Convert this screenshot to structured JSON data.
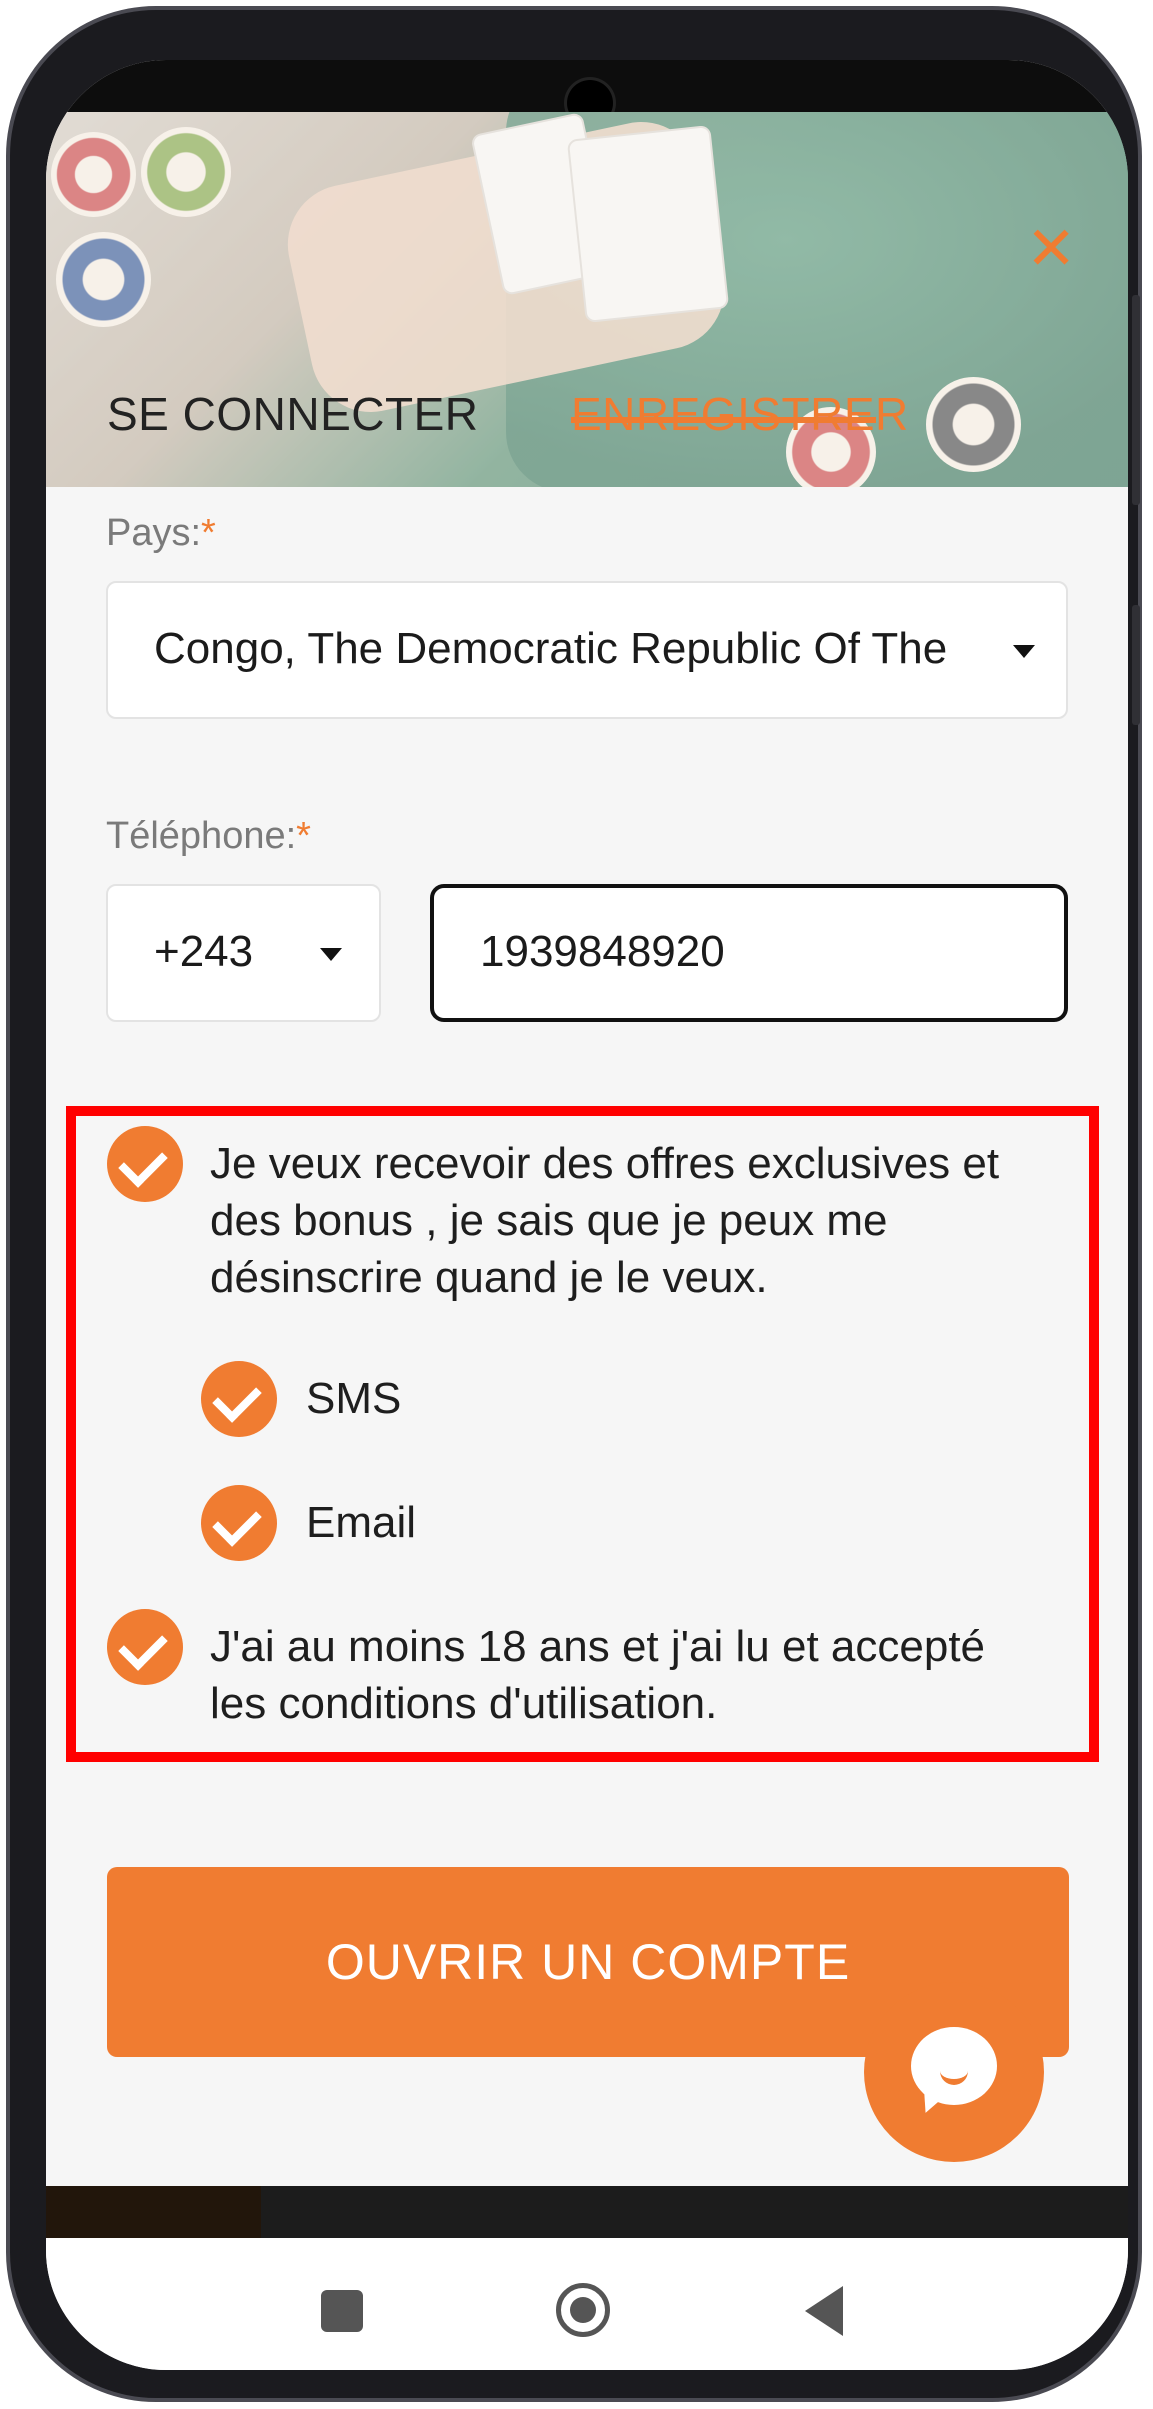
{
  "header": {
    "tabs": [
      {
        "label": "SE CONNECTER",
        "active": false
      },
      {
        "label": "ENREGISTRER",
        "active": true
      }
    ],
    "close_icon": "close-icon",
    "background_image": "casino-cards-chips-photo"
  },
  "form": {
    "country": {
      "label": "Pays:",
      "required_marker": "*",
      "value": "Congo, The Democratic Republic Of The"
    },
    "phone": {
      "label": "Téléphone:",
      "required_marker": "*",
      "country_code": "+243",
      "number": "1939848920"
    },
    "options": {
      "promo": {
        "checked": true,
        "lines": [
          "Je veux recevoir des offres exclusives et",
          "des bonus , je sais que je peux me",
          "désinscrire quand je le veux."
        ]
      },
      "sms": {
        "checked": true,
        "label": "SMS"
      },
      "email": {
        "checked": true,
        "label": "Email"
      },
      "terms": {
        "checked": true,
        "lines": [
          "J'ai au moins 18 ans et j'ai lu et accepté",
          "les conditions d'utilisation."
        ]
      }
    },
    "submit_label": "OUVRIR UN COMPTE"
  },
  "chat": {
    "icon": "chat-bubble-icon"
  },
  "navbar": {
    "icons": [
      "recent-apps-icon",
      "home-icon",
      "back-icon"
    ]
  },
  "colors": {
    "accent": "#f07c31",
    "highlight_border": "#ff0000",
    "background": "#f6f6f6"
  }
}
